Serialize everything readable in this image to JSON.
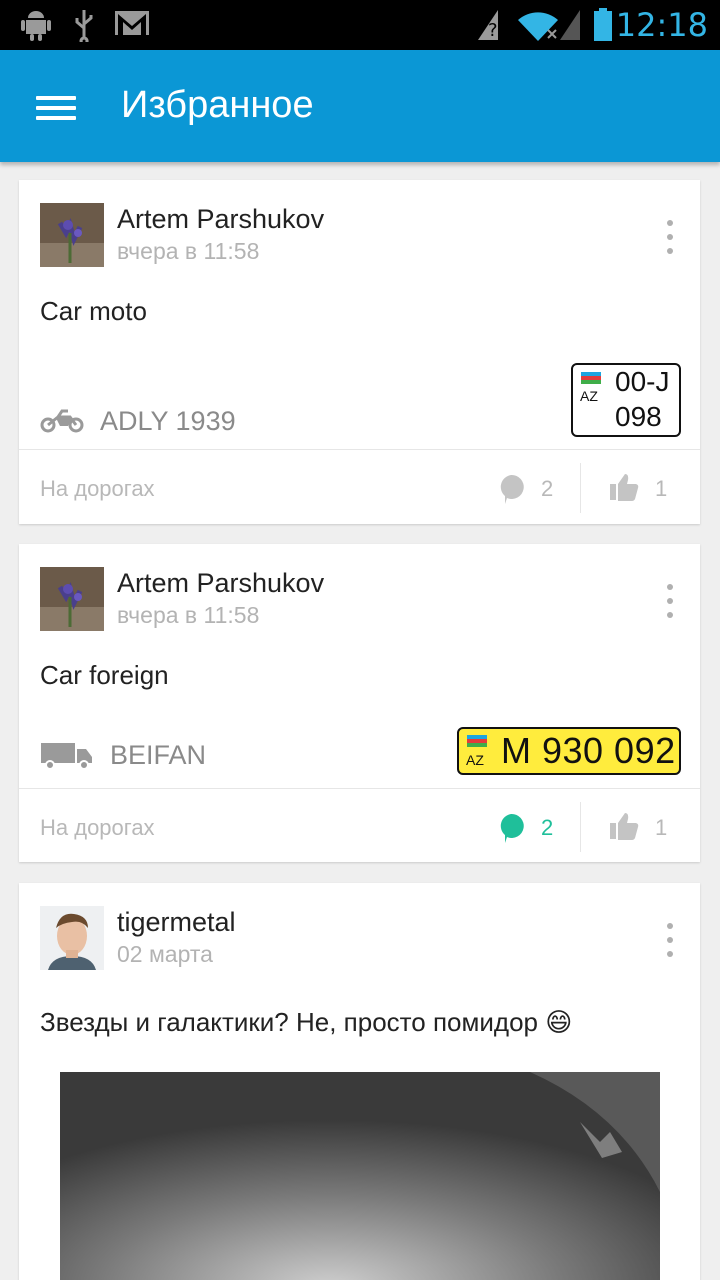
{
  "status_bar": {
    "time": "12:18",
    "icons": [
      "android-icon",
      "usb-icon",
      "gmail-icon",
      "unknown-network-icon",
      "wifi-icon",
      "battery-icon"
    ]
  },
  "app_bar": {
    "title": "Избранное",
    "menu_icon": "hamburger-icon"
  },
  "posts": [
    {
      "author": "Artem Parshukov",
      "time": "вчера в 11:58",
      "text": "Car moto",
      "vehicle_icon": "motorcycle-icon",
      "vehicle": "ADLY 1939",
      "plate": {
        "country": "AZ",
        "line1": "00-J",
        "line2": "098",
        "style": "white"
      },
      "category": "На дорогах",
      "comments": "2",
      "likes": "1",
      "comment_color": "#c4c4c4"
    },
    {
      "author": "Artem Parshukov",
      "time": "вчера в 11:58",
      "text": "Car foreign",
      "vehicle_icon": "truck-icon",
      "vehicle": "BEIFAN",
      "plate": {
        "country": "AZ",
        "number": "M 930 092",
        "style": "yellow"
      },
      "category": "На дорогах",
      "comments": "2",
      "likes": "1",
      "comment_color": "#1fbf9a"
    },
    {
      "author": "tigermetal",
      "time": "02 марта",
      "text": "Звезды и галактики? Не, просто помидор 😄",
      "has_photo": true
    }
  ]
}
